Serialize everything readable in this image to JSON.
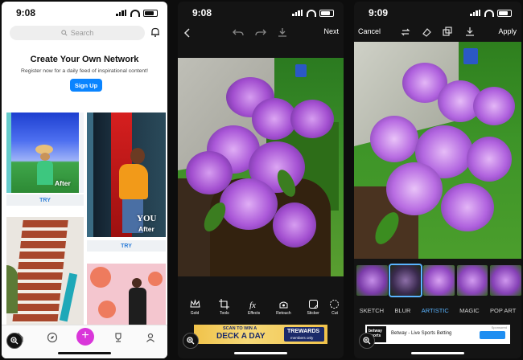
{
  "phone1": {
    "status_time": "9:08",
    "search_placeholder": "Search",
    "headline": "Create Your Own Network",
    "subline": "Register now for a daily feed of inspirational content!",
    "signup_label": "Sign Up",
    "card1_label": "After",
    "card2_label": "After",
    "card2_overlay": "YOU",
    "try_label_1": "TRY",
    "try_label_2": "TRY",
    "tabs": [
      "home-icon",
      "compass-icon",
      "plus-icon",
      "trophy-icon",
      "profile-icon"
    ]
  },
  "phone2": {
    "status_time": "9:08",
    "next_label": "Next",
    "tools": [
      {
        "icon": "crown-icon",
        "label": "Gold"
      },
      {
        "icon": "crop-icon",
        "label": "Tools"
      },
      {
        "icon": "fx-icon",
        "label": "Effects"
      },
      {
        "icon": "retouch-icon",
        "label": "Retouch"
      },
      {
        "icon": "sticker-icon",
        "label": "Sticker"
      },
      {
        "icon": "cutout-icon",
        "label": "Cut"
      }
    ],
    "ad_line1": "SCAN TO WIN A",
    "ad_line2": "DECK A DAY",
    "ad_brand": "TREWARDS",
    "ad_note": "members only"
  },
  "phone3": {
    "status_time": "9:09",
    "cancel_label": "Cancel",
    "apply_label": "Apply",
    "categories": [
      "SKETCH",
      "BLUR",
      "ARTISTIC",
      "MAGIC",
      "POP ART"
    ],
    "active_category": "ARTISTIC",
    "ad_brand": "betway sports",
    "ad_text": "Betway - Live Sports Betting",
    "ad_tag": "Sponsored"
  },
  "colors": {
    "accent_blue": "#0a84ff",
    "plus_magenta": "#d936d9",
    "artistic_blue": "#5ab4ff"
  }
}
